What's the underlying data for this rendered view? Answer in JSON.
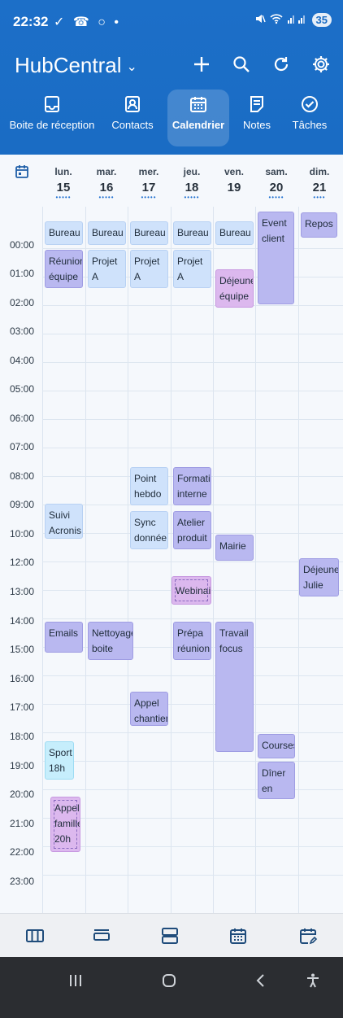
{
  "status": {
    "time": "22:32",
    "left_icons": "✓ ☎ ○ •",
    "battery": "35"
  },
  "header": {
    "title": "HubCentral",
    "chevron": "⌄"
  },
  "nav": [
    {
      "label": "Boite de réception"
    },
    {
      "label": "Contacts"
    },
    {
      "label": "Calendrier"
    },
    {
      "label": "Notes"
    },
    {
      "label": "Tâches"
    }
  ],
  "days": [
    {
      "name": "lun.",
      "date": "15",
      "dots": "•••••"
    },
    {
      "name": "mar.",
      "date": "16",
      "dots": "•••••"
    },
    {
      "name": "mer.",
      "date": "17",
      "dots": "•••••"
    },
    {
      "name": "jeu.",
      "date": "18",
      "dots": "•••••"
    },
    {
      "name": "ven.",
      "date": "19",
      "dots": ""
    },
    {
      "name": "sam.",
      "date": "20",
      "dots": "•••••"
    },
    {
      "name": "dim.",
      "date": "21",
      "dots": "••••"
    }
  ],
  "hours": [
    "00:00",
    "01:00",
    "02:00",
    "03:00",
    "04:00",
    "05:00",
    "06:00",
    "07:00",
    "08:00",
    "09:00",
    "10:00",
    "12:00",
    "13:00",
    "14:00",
    "15:00",
    "16:00",
    "17:00",
    "18:00",
    "19:00",
    "20:00",
    "21:00",
    "22:00",
    "23:00"
  ],
  "events": [
    {
      "title": "Bureau",
      "color": "#cfe2fb"
    },
    {
      "title": "Réunion\néquipe",
      "color": "#b9b8f0"
    },
    {
      "title": "Suivi\nAcronis",
      "color": "#cfe2fb"
    },
    {
      "title": "Emails",
      "color": "#b9b8f0"
    },
    {
      "title": "Sport\n18h",
      "color": "#c6eefc"
    },
    {
      "title": "Appel\nfamille\n20h",
      "color": "#dcb8ee"
    },
    {
      "title": "Bureau",
      "color": "#cfe2fb"
    },
    {
      "title": "Projet A\npoint",
      "color": "#cfe2fb"
    },
    {
      "title": "Nettoyage\nboite mail",
      "color": "#b9b8f0"
    },
    {
      "title": "Bureau",
      "color": "#cfe2fb"
    },
    {
      "title": "Projet A\npoint",
      "color": "#cfe2fb"
    },
    {
      "title": "Point\nhebdo",
      "color": "#cfe2fb"
    },
    {
      "title": "Sync\ndonnée",
      "color": "#cfe2fb"
    },
    {
      "title": "Appel\nchantier",
      "color": "#b9b8f0"
    },
    {
      "title": "Bureau",
      "color": "#cfe2fb"
    },
    {
      "title": "Projet A\npoint",
      "color": "#cfe2fb"
    },
    {
      "title": "Formatio\ninterne",
      "color": "#b9b8f0"
    },
    {
      "title": "Atelier\nproduit",
      "color": "#b9b8f0"
    },
    {
      "title": "Webinaire",
      "color": "#dcb8ee"
    },
    {
      "title": "Prépa\nréunion",
      "color": "#b9b8f0"
    },
    {
      "title": "Bureau",
      "color": "#cfe2fb"
    },
    {
      "title": "Déjeuner\néquipe",
      "color": "#dcb8ee"
    },
    {
      "title": "Mairie",
      "color": "#b9b8f0"
    },
    {
      "title": "Travail\nfocus",
      "color": "#b9b8f0"
    },
    {
      "title": "Event\nclient",
      "color": "#b9b8f0"
    },
    {
      "title": "Courses",
      "color": "#b9b8f0"
    },
    {
      "title": "Dîner en\nville",
      "color": "#b9b8f0"
    },
    {
      "title": "Repos",
      "color": "#b9b8f0"
    },
    {
      "title": "Déjeuner\nJulie",
      "color": "#b9b8f0"
    }
  ],
  "icons": {
    "header": [
      "add-icon",
      "search-icon",
      "refresh-icon",
      "settings-icon"
    ],
    "bottom": [
      "week-view-icon",
      "day-view-icon",
      "agenda-view-icon",
      "month-view-icon",
      "edit-calendar-icon"
    ],
    "system": [
      "recent-apps-icon",
      "home-icon",
      "back-icon",
      "accessibility-icon"
    ]
  }
}
